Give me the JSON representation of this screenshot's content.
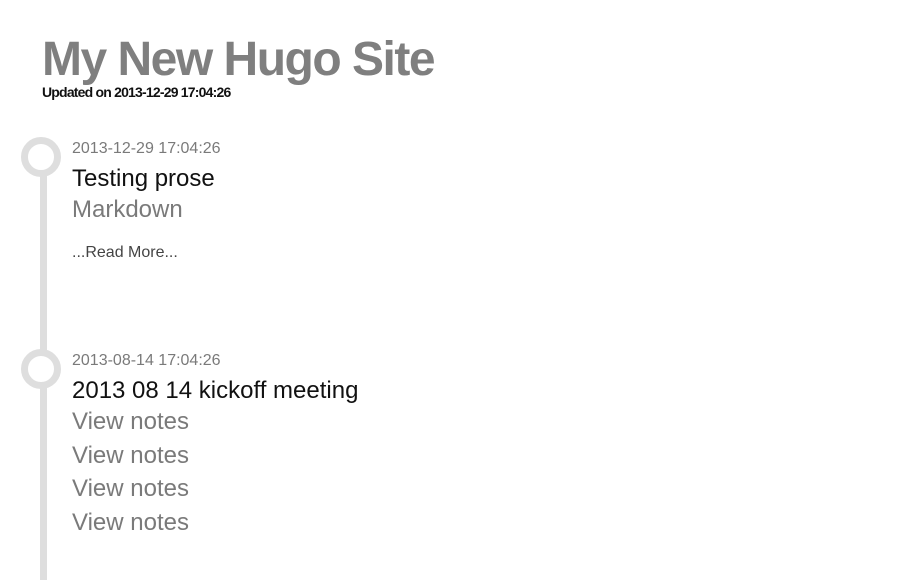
{
  "site": {
    "title": "My New Hugo Site",
    "updated": "Updated on 2013-12-29 17:04:26"
  },
  "posts": [
    {
      "date": "2013-12-29 17:04:26",
      "title": "Testing prose",
      "tag": "Markdown",
      "read_more": "...Read More..."
    },
    {
      "date": "2013-08-14 17:04:26",
      "title": "2013 08 14 kickoff meeting",
      "links": [
        "View notes",
        "View notes",
        "View notes",
        "View notes"
      ]
    }
  ],
  "colors": {
    "title": "#7f7f7f",
    "timeline": "#dedede",
    "muted_text": "#7a7a7a",
    "text": "#111111"
  }
}
